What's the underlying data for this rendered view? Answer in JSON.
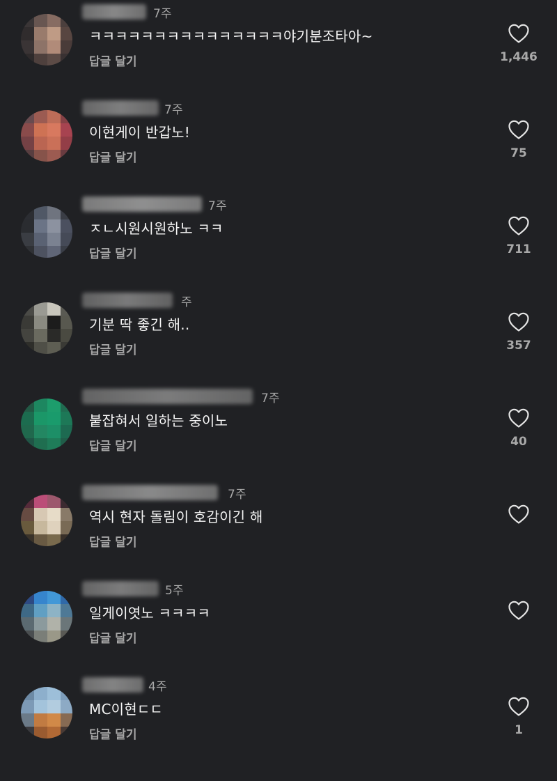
{
  "comments": [
    {
      "time": "7주",
      "text": "ㅋㅋㅋㅋㅋㅋㅋㅋㅋㅋㅋㅋㅋㅋㅋ야기분조타아~",
      "reply_label": "답글 달기",
      "likes": "1,446",
      "avatar_colors": [
        "#3a3536",
        "#6a5650",
        "#8a6b60",
        "#4c3f3c",
        "#302c2d",
        "#9c7a6a",
        "#c29a82",
        "#5a4640",
        "#3b3435",
        "#8f7266",
        "#b48a76",
        "#4a3b38",
        "#2e2a2b",
        "#4f403c",
        "#5d4b45",
        "#3a3132"
      ],
      "username_blur_colors": [
        "#7a7a7a",
        "#9a9a9a"
      ]
    },
    {
      "time": "7주",
      "text": "이현게이 반갑노!",
      "reply_label": "답글 달기",
      "likes": "75",
      "avatar_colors": [
        "#6a4a4f",
        "#a15a4f",
        "#c46b54",
        "#8b3f45",
        "#8f4a4a",
        "#d6704f",
        "#e0775a",
        "#b0414f",
        "#7a4044",
        "#c2634e",
        "#d26e53",
        "#9a3c46",
        "#5a3d40",
        "#8a5248",
        "#a25a4e",
        "#6d3a3f"
      ],
      "username_blur_colors": [
        "#727272",
        "#8f8f8f"
      ]
    },
    {
      "time": "7주",
      "text": "ㅈㄴ시원시원하노 ㅋㅋ",
      "reply_label": "답글 달기",
      "likes": "711",
      "avatar_colors": [
        "#2b2d33",
        "#4f5868",
        "#6e7480",
        "#3a3d46",
        "#2a2c31",
        "#6a7488",
        "#8b92a2",
        "#4a5061",
        "#3a3d44",
        "#596275",
        "#7a8293",
        "#454a58",
        "#2f3136",
        "#4c5262",
        "#5f6679",
        "#3a3e48"
      ],
      "username_blur_colors": [
        "#8a8a8a",
        "#a3a3a3"
      ]
    },
    {
      "time": "주",
      "text": "기분 딱 좋긴 해..",
      "reply_label": "답글 달기",
      "likes": "357",
      "avatar_colors": [
        "#4a4a46",
        "#9a9a92",
        "#c8c6bb",
        "#5a5a52",
        "#3a3a36",
        "#8a8a80",
        "#1c1c1c",
        "#58584e",
        "#44443e",
        "#6a6a5e",
        "#2a2a28",
        "#4a4a40",
        "#2e2e2a",
        "#4f4f46",
        "#5e5e52",
        "#3a3a34"
      ],
      "username_blur_colors": [
        "#6c6c6c",
        "#8a8a8a"
      ]
    },
    {
      "time": "7주",
      "text": "붙잡혀서 일하는 중이노",
      "reply_label": "답글 달기",
      "likes": "40",
      "avatar_colors": [
        "#1d5a44",
        "#148a5e",
        "#12a06a",
        "#1a6e50",
        "#156e4e",
        "#119a66",
        "#0f9e6a",
        "#157a56",
        "#1a6a4c",
        "#1a8a60",
        "#139266",
        "#176c50",
        "#1b5646",
        "#18704f",
        "#177e58",
        "#1b5f48"
      ],
      "username_blur_colors": [
        "#6f6f6f",
        "#8c8c8c"
      ]
    },
    {
      "time": "7주",
      "text": "역시 현자 돌림이 호감이긴 해",
      "reply_label": "답글 달기",
      "likes": "",
      "avatar_colors": [
        "#5a2a3a",
        "#c44b7a",
        "#a3566e",
        "#3c2a30",
        "#6a4a40",
        "#d8c8b0",
        "#e8dcc6",
        "#8a7a66",
        "#6a5a3a",
        "#c8b89a",
        "#e0d2ba",
        "#7a6a52",
        "#3a3228",
        "#6a5a40",
        "#7a6a4a",
        "#3a3028"
      ],
      "username_blur_colors": [
        "#7d7d7d",
        "#9c9c9c"
      ]
    },
    {
      "time": "5주",
      "text": "일게이엿노 ㅋㅋㅋㅋ",
      "reply_label": "답글 달기",
      "likes": "",
      "avatar_colors": [
        "#2a4a8a",
        "#2f86d6",
        "#3a9ae0",
        "#2a6ab0",
        "#3a6a8a",
        "#5aa0c8",
        "#8ab4c8",
        "#4a7a9a",
        "#5a6a72",
        "#8a9a9e",
        "#b0b2a8",
        "#6a767a",
        "#4a4e50",
        "#7a7e78",
        "#9a9886",
        "#5a5a54"
      ],
      "username_blur_colors": [
        "#707070",
        "#8c8c8c"
      ]
    },
    {
      "time": "4주",
      "text": "MC이현ㄷㄷ",
      "reply_label": "답글 달기",
      "likes": "1",
      "avatar_colors": [
        "#6a8aa8",
        "#8ab0d0",
        "#9ac0dc",
        "#7a9ebe",
        "#7a9aba",
        "#a0c4de",
        "#b0cce2",
        "#8aaac8",
        "#6a7a8a",
        "#c87a3a",
        "#d88840",
        "#8a6a50",
        "#3a3a3e",
        "#a05a2a",
        "#b8682e",
        "#4a3a34"
      ],
      "username_blur_colors": [
        "#7a7a7a",
        "#959595"
      ]
    }
  ]
}
